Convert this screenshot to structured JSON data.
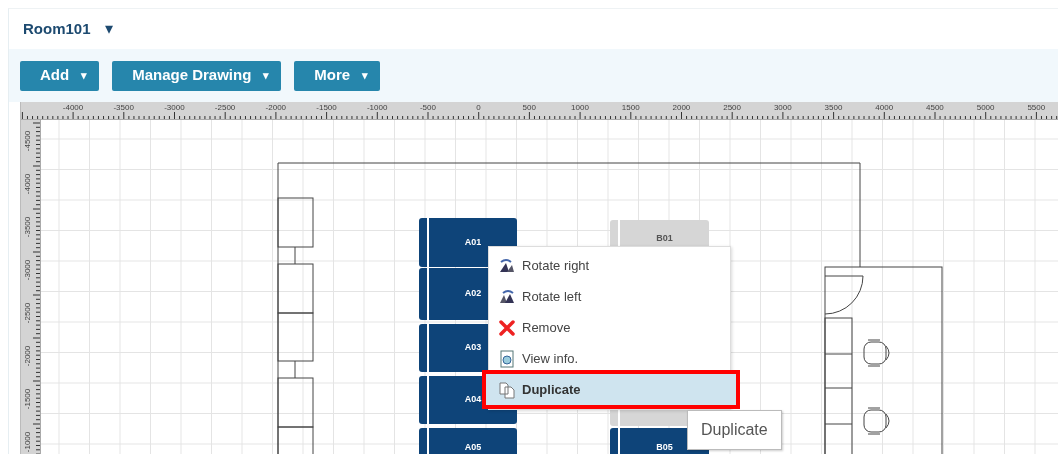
{
  "room": {
    "title": "Room101",
    "caret": "▾"
  },
  "toolbar": [
    {
      "label": "Add",
      "caret": "▾"
    },
    {
      "label": "Manage Drawing",
      "caret": "▾"
    },
    {
      "label": "More",
      "caret": "▾"
    }
  ],
  "ruler": {
    "x_labels": [
      "-4000",
      "-3500",
      "-3000",
      "-2500",
      "-2000",
      "-1500",
      "-1000",
      "-500",
      "0",
      "500",
      "1000",
      "1500",
      "2000",
      "2500",
      "3000",
      "3500",
      "4000",
      "4500",
      "5000",
      "5500"
    ],
    "y_labels": [
      "-4500",
      "-4000",
      "-3500",
      "-3000",
      "-2500",
      "-2000",
      "-1500",
      "-1000"
    ]
  },
  "desks": [
    {
      "label": "A01",
      "color": "#0e4479"
    },
    {
      "label": "A02",
      "color": "#0e4479"
    },
    {
      "label": "A03",
      "color": "#0e4479"
    },
    {
      "label": "A04",
      "color": "#0e4479"
    },
    {
      "label": "A05",
      "color": "#0e4479"
    },
    {
      "label": "B01",
      "color": "#d6d6d6"
    },
    {
      "color": "#d6d6d6"
    },
    {
      "label": "B05",
      "color": "#0e4479"
    }
  ],
  "context_menu": [
    {
      "kind": "rotate-right",
      "label": "Rotate right",
      "selected": false
    },
    {
      "kind": "rotate-left",
      "label": "Rotate left",
      "selected": false
    },
    {
      "kind": "remove",
      "label": "Remove",
      "selected": false
    },
    {
      "kind": "view-info",
      "label": "View info.",
      "selected": false
    },
    {
      "kind": "duplicate",
      "label": "Duplicate",
      "selected": true
    }
  ],
  "tooltip": "Duplicate"
}
